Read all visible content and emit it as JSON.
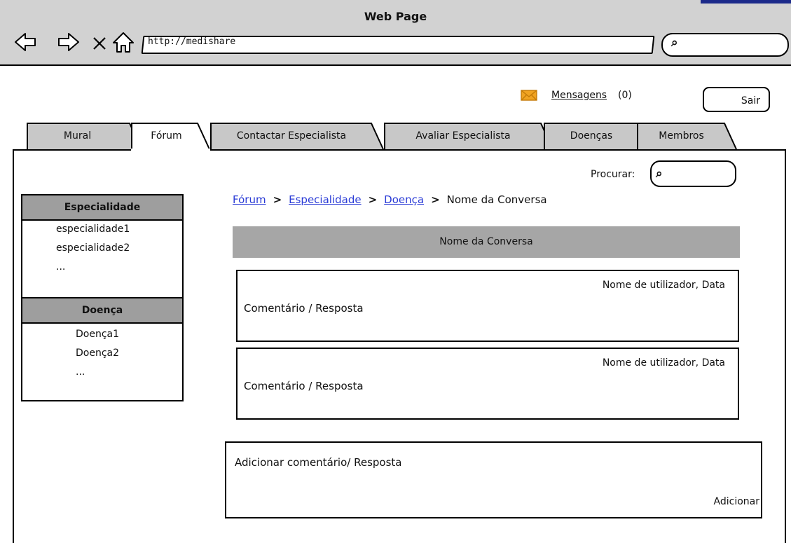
{
  "window": {
    "title": "Web Page",
    "url": "http://medishare"
  },
  "header": {
    "messages_label": "Mensagens",
    "messages_count": "(0)",
    "logout_label": "Sair"
  },
  "tabs": [
    {
      "label": "Mural"
    },
    {
      "label": "Fórum",
      "active": true
    },
    {
      "label": "Contactar Especialista"
    },
    {
      "label": "Avaliar Especialista"
    },
    {
      "label": "Doenças"
    },
    {
      "label": "Membros"
    }
  ],
  "search": {
    "label": "Procurar:"
  },
  "sidebar": {
    "specialty": {
      "title": "Especialidade",
      "items": [
        "especialidade1",
        "especialidade2",
        "..."
      ]
    },
    "disease": {
      "title": "Doença",
      "items": [
        "Doença1",
        "Doença2",
        "..."
      ]
    }
  },
  "breadcrumb": {
    "forum": "Fórum",
    "specialty": "Especialidade",
    "disease": "Doença",
    "current": "Nome da Conversa",
    "separator": ">"
  },
  "conversation": {
    "title": "Nome da Conversa",
    "comments": [
      {
        "meta": "Nome de utilizador, Data",
        "text": "Comentário / Resposta"
      },
      {
        "meta": "Nome de utilizador, Data",
        "text": "Comentário / Resposta"
      }
    ]
  },
  "add_comment": {
    "prompt": "Adicionar comentário/ Resposta",
    "button": "Adicionar"
  },
  "colors": {
    "chrome": "#d2d2d2",
    "tab_inactive": "#c8c8c8",
    "header_bar": "#a6a6a6",
    "sidebar_header": "#9e9e9e",
    "link": "#2a3bd6",
    "mail_icon": "#f0a321"
  }
}
